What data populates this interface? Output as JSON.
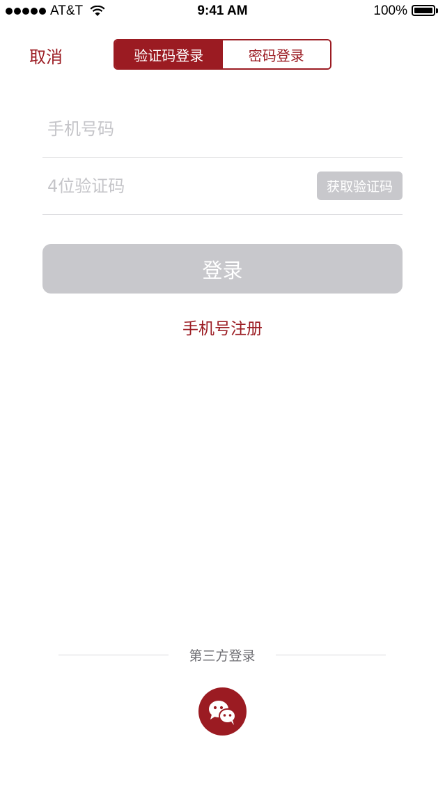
{
  "status_bar": {
    "carrier": "AT&T",
    "time": "9:41 AM",
    "battery": "100%"
  },
  "nav": {
    "cancel_label": "取消",
    "tabs": [
      {
        "label": "验证码登录",
        "active": true
      },
      {
        "label": "密码登录",
        "active": false
      }
    ]
  },
  "form": {
    "phone_placeholder": "手机号码",
    "code_placeholder": "4位验证码",
    "get_code_label": "获取验证码",
    "login_label": "登录",
    "register_label": "手机号注册"
  },
  "third_party": {
    "label": "第三方登录",
    "providers": [
      {
        "icon": "wechat-icon"
      }
    ]
  },
  "colors": {
    "accent": "#9b1b22",
    "disabled": "#c8c8cc",
    "placeholder": "#c5c5c9",
    "divider": "#d9d9dc"
  }
}
